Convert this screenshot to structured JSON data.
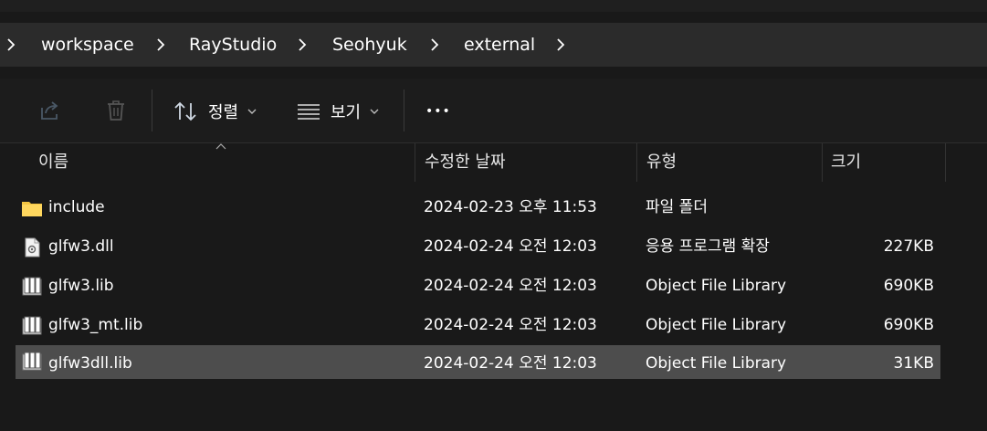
{
  "breadcrumb": {
    "items": [
      {
        "label": "workspace"
      },
      {
        "label": "RayStudio"
      },
      {
        "label": "Seohyuk"
      },
      {
        "label": "external"
      }
    ]
  },
  "toolbar": {
    "share_icon": "share-icon",
    "delete_icon": "trash-icon",
    "sort_label": "정렬",
    "view_label": "보기",
    "more_label": "•••"
  },
  "columns": {
    "name": "이름",
    "date": "수정한 날짜",
    "type": "유형",
    "size": "크기"
  },
  "files": [
    {
      "name": "include",
      "date": "2024-02-23 오후 11:53",
      "type": "파일 폴더",
      "size": "",
      "icon": "folder-icon"
    },
    {
      "name": "glfw3.dll",
      "date": "2024-02-24 오전 12:03",
      "type": "응용 프로그램 확장",
      "size": "227KB",
      "icon": "dll-file-icon"
    },
    {
      "name": "glfw3.lib",
      "date": "2024-02-24 오전 12:03",
      "type": "Object File Library",
      "size": "690KB",
      "icon": "lib-file-icon"
    },
    {
      "name": "glfw3_mt.lib",
      "date": "2024-02-24 오전 12:03",
      "type": "Object File Library",
      "size": "690KB",
      "icon": "lib-file-icon"
    },
    {
      "name": "glfw3dll.lib",
      "date": "2024-02-24 오전 12:03",
      "type": "Object File Library",
      "size": "31KB",
      "icon": "lib-file-icon",
      "selected": true
    }
  ],
  "colors": {
    "background": "#191919",
    "address_bar": "#2b2b2b",
    "selected_row": "#4d4d4d",
    "folder": "#f4c542"
  }
}
